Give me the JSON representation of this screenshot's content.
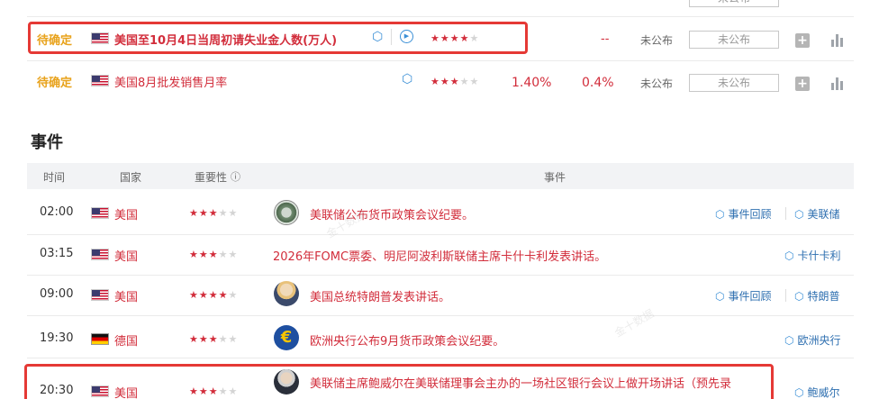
{
  "indicators": [
    {
      "status": "待确定",
      "name": "美国至10月4日当周初请失业金人数(万人)",
      "stars_on": 4,
      "stars_off": 1,
      "previous": "",
      "forecast": "--",
      "actual": "未公布",
      "actual_box": "未公布",
      "country": "US",
      "has_play": true
    },
    {
      "status": "待确定",
      "name": "美国8月批发销售月率",
      "stars_on": 3,
      "stars_off": 2,
      "previous": "1.40%",
      "forecast": "0.4%",
      "actual": "未公布",
      "actual_box": "未公布",
      "country": "US",
      "has_play": false
    }
  ],
  "top_partial_box": "未公布",
  "events_section": {
    "title": "事件",
    "headers": {
      "time": "时间",
      "country": "国家",
      "importance": "重要性",
      "importance_icon": "ⓘ",
      "event": "事件"
    },
    "rows": [
      {
        "time": "02:00",
        "country": "美国",
        "flag": "us",
        "stars_on": 3,
        "stars_off": 2,
        "avatar": "fed-seal",
        "text": "美联储公布货币政策会议纪要。",
        "links": [
          "事件回顾",
          "美联储"
        ]
      },
      {
        "time": "03:15",
        "country": "美国",
        "flag": "us",
        "stars_on": 3,
        "stars_off": 2,
        "avatar": "",
        "text": "2026年FOMC票委、明尼阿波利斯联储主席卡什卡利发表讲话。",
        "links": [
          "卡什卡利"
        ]
      },
      {
        "time": "09:00",
        "country": "美国",
        "flag": "us",
        "stars_on": 4,
        "stars_off": 1,
        "avatar": "portrait",
        "text": "美国总统特朗普发表讲话。",
        "links": [
          "事件回顾",
          "特朗普"
        ]
      },
      {
        "time": "19:30",
        "country": "德国",
        "flag": "de",
        "stars_on": 3,
        "stars_off": 2,
        "avatar": "euro",
        "text": "欧洲央行公布9月货币政策会议纪要。",
        "links": [
          "欧洲央行"
        ]
      },
      {
        "time": "20:30",
        "country": "美国",
        "flag": "us",
        "stars_on": 3,
        "stars_off": 2,
        "avatar": "portrait2",
        "text": "美联储主席鲍威尔在美联储理事会主办的一场社区银行会议上做开场讲话（预先录",
        "links": [
          "鲍威尔"
        ]
      }
    ]
  },
  "colors": {
    "accent_red": "#d22d3b",
    "status_orange": "#e8a21b",
    "link_blue": "#2e6fb0",
    "highlight": "#e53935"
  },
  "watermark": "金十数据"
}
